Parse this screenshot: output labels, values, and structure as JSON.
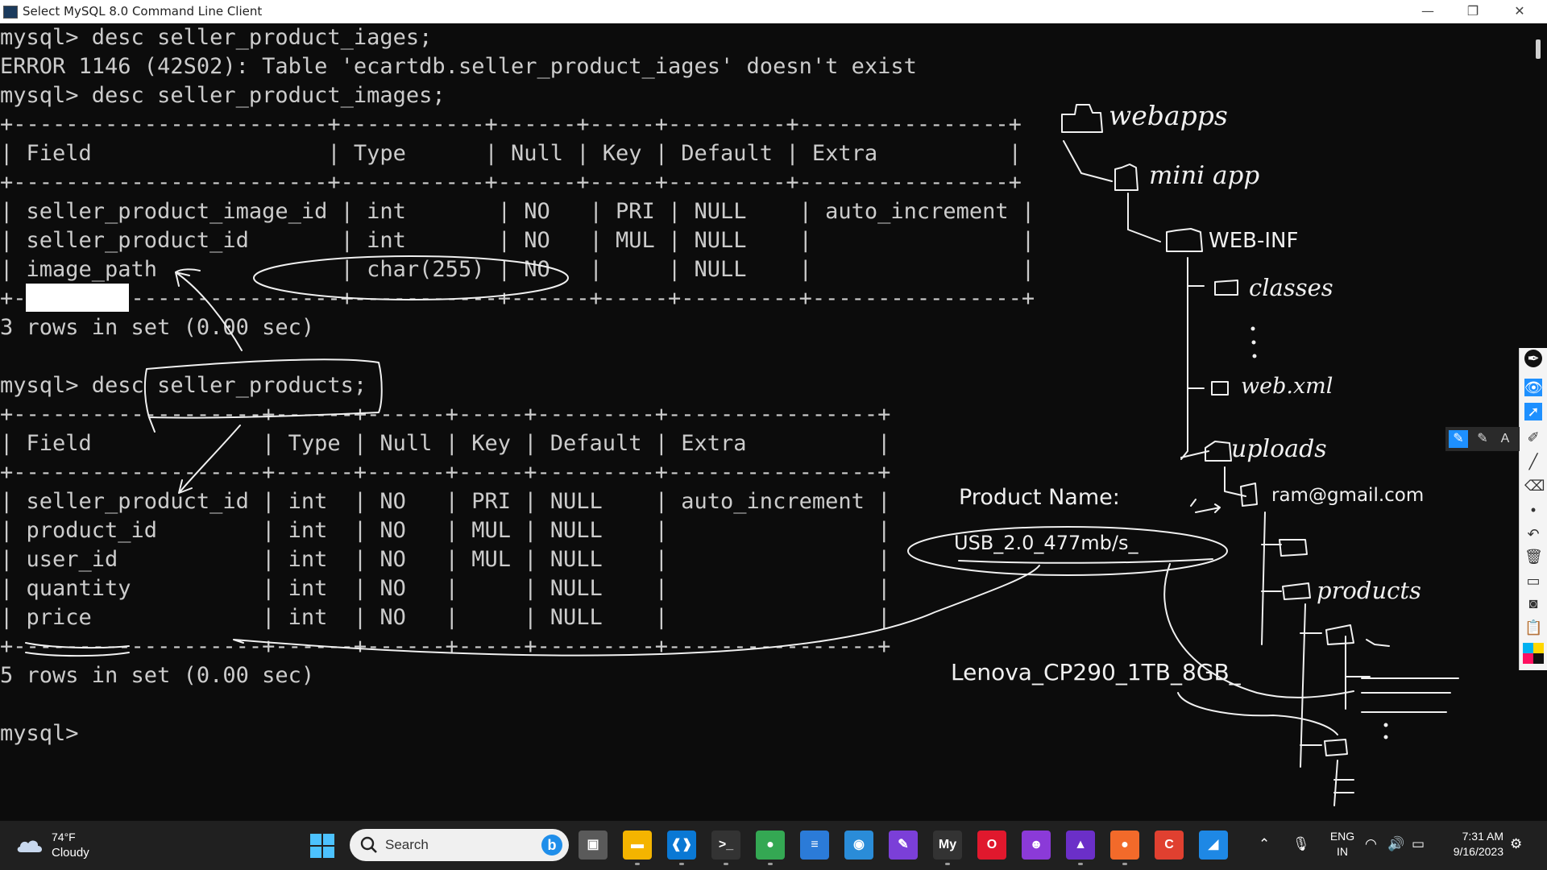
{
  "window": {
    "title": "Select MySQL 8.0 Command Line Client",
    "minimize": "—",
    "restore": "❐",
    "close": "✕"
  },
  "console": {
    "text": "mysql> desc seller_product_iages;\nERROR 1146 (42S02): Table 'ecartdb.seller_product_iages' doesn't exist\nmysql> desc seller_product_images;\n+------------------------+-----------+------+-----+---------+----------------+\n| Field                  | Type      | Null | Key | Default | Extra          |\n+------------------------+-----------+------+-----+---------+----------------+\n| seller_product_image_id | int       | NO   | PRI | NULL    | auto_increment |\n| seller_product_id       | int       | NO   | MUL | NULL    |                |\n| image_path              | char(255) | NO   |     | NULL    |                |\n+-------------------------+-----------+------+-----+---------+----------------+\n3 rows in set (0.00 sec)\n\nmysql> desc seller_products;\n+-------------------+------+------+-----+---------+----------------+\n| Field             | Type | Null | Key | Default | Extra          |\n+-------------------+------+------+-----+---------+----------------+\n| seller_product_id | int  | NO   | PRI | NULL    | auto_increment |\n| product_id        | int  | NO   | MUL | NULL    |                |\n| user_id           | int  | NO   | MUL | NULL    |                |\n| quantity          | int  | NO   |     | NULL    |                |\n| price             | int  | NO   |     | NULL    |                |\n+-------------------+------+------+-----+---------+----------------+\n5 rows in set (0.00 sec)\n\nmysql>"
  },
  "annotations": {
    "webapps": "webapps",
    "miniapp": "mini app",
    "webinf": "WEB-INF",
    "classes": "classes",
    "webxml": "web.xml",
    "uploads": "uploads",
    "email": "ram@gmail.com",
    "products": "products",
    "product_name_label": "Product Name:",
    "product_name_1": "USB_2.0_477mb/s_",
    "product_name_2": "Lenova_CP290_1TB_8GB_"
  },
  "pen_toolbar": {
    "tools": [
      "pen-icon",
      "eye-icon",
      "cursor-icon",
      "highlighter-icon",
      "line-icon",
      "eraser-icon",
      "dot-icon",
      "undo-icon",
      "trash-icon",
      "screen-icon",
      "camera-icon",
      "clipboard-icon",
      "palette-icon"
    ],
    "sub_label": "A"
  },
  "taskbar": {
    "weather_temp": "74°F",
    "weather_condition": "Cloudy",
    "search_placeholder": "Search",
    "apps": [
      {
        "name": "task-view",
        "color": "#5a5a5a",
        "glyph": "▣"
      },
      {
        "name": "file-explorer",
        "color": "#f4b400",
        "glyph": "▬"
      },
      {
        "name": "vs-code",
        "color": "#0a78d4",
        "glyph": "❰❱"
      },
      {
        "name": "terminal",
        "color": "#333333",
        "glyph": ">_"
      },
      {
        "name": "chrome",
        "color": "#34a853",
        "glyph": "●"
      },
      {
        "name": "notepad",
        "color": "#2b7bd8",
        "glyph": "≡"
      },
      {
        "name": "browser",
        "color": "#2a8cd8",
        "glyph": "◉"
      },
      {
        "name": "pen-tool",
        "color": "#7b3fd8",
        "glyph": "✎"
      },
      {
        "name": "mysql-client",
        "color": "#333333",
        "glyph": "My"
      },
      {
        "name": "opera",
        "color": "#e0182d",
        "glyph": "O"
      },
      {
        "name": "game-app",
        "color": "#8b3ad8",
        "glyph": "☻"
      },
      {
        "name": "colorful-app",
        "color": "#6b2fc8",
        "glyph": "▲"
      },
      {
        "name": "firefox",
        "color": "#f26a2a",
        "glyph": "●"
      },
      {
        "name": "red-app",
        "color": "#e04030",
        "glyph": "C"
      },
      {
        "name": "blue-app",
        "color": "#1e88e5",
        "glyph": "◢"
      }
    ],
    "language_primary": "ENG",
    "language_secondary": "IN",
    "time": "7:31 AM",
    "date": "9/16/2023"
  }
}
